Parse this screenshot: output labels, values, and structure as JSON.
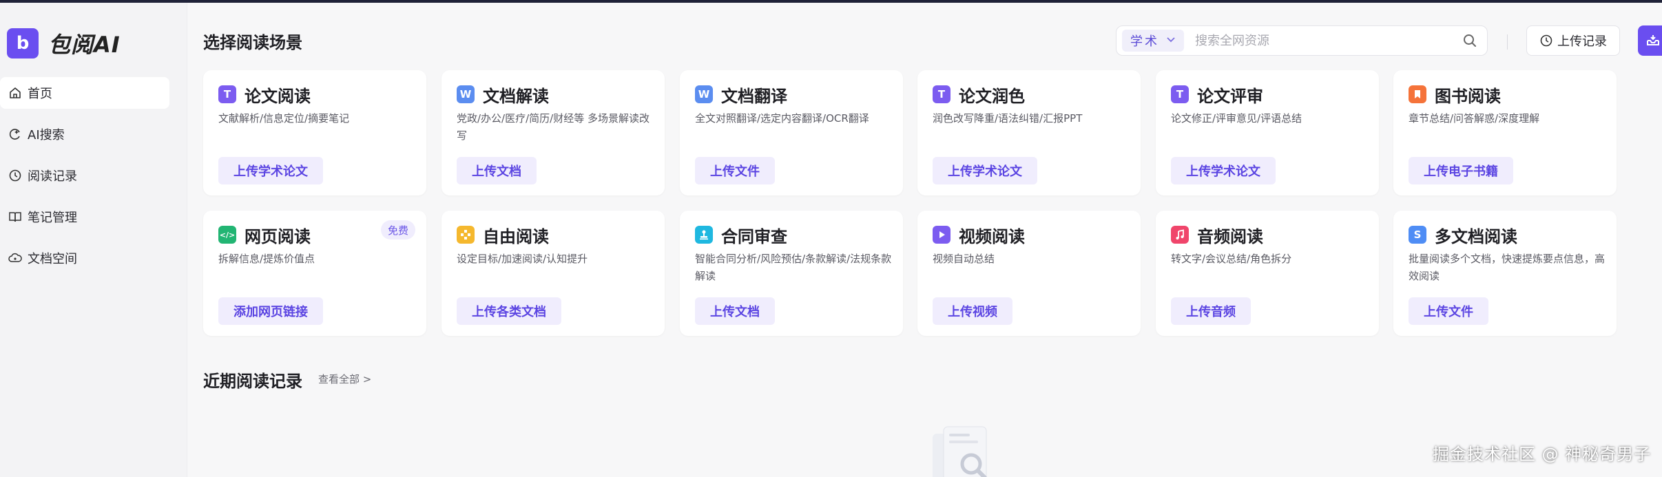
{
  "app": {
    "logo_letter": "b",
    "name": "包阅AI"
  },
  "sidebar": {
    "items": [
      {
        "label": "首页",
        "icon": "home-icon",
        "active": true
      },
      {
        "label": "AI搜索",
        "icon": "ai-search-icon"
      },
      {
        "label": "阅读记录",
        "icon": "clock-icon"
      },
      {
        "label": "笔记管理",
        "icon": "book-icon"
      },
      {
        "label": "文档空间",
        "icon": "cloud-folder-icon"
      }
    ]
  },
  "header": {
    "title": "选择阅读场景",
    "search": {
      "scope": "学术",
      "placeholder": "搜索全网资源"
    },
    "upload_record_label": "上传记录"
  },
  "cards": [
    {
      "title": "论文阅读",
      "icon": "T",
      "icon_color": "#7c5cf0",
      "desc": "文献解析/信息定位/摘要笔记",
      "button": "上传学术论文"
    },
    {
      "title": "文档解读",
      "icon": "W",
      "icon_color": "#5b8df0",
      "desc": "党政/办公/医疗/简历/财经等 多场景解读改写",
      "button": "上传文档"
    },
    {
      "title": "文档翻译",
      "icon": "W",
      "icon_color": "#5b8df0",
      "desc": "全文对照翻译/选定内容翻译/OCR翻译",
      "button": "上传文件"
    },
    {
      "title": "论文润色",
      "icon": "T",
      "icon_color": "#7c5cf0",
      "desc": "润色改写降重/语法纠错/汇报PPT",
      "button": "上传学术论文"
    },
    {
      "title": "论文评审",
      "icon": "T",
      "icon_color": "#7c5cf0",
      "desc": "论文修正/评审意见/评语总结",
      "button": "上传学术论文"
    },
    {
      "title": "图书阅读",
      "icon": "bookmark",
      "icon_color": "#f5733a",
      "desc": "章节总结/问答解惑/深度理解",
      "button": "上传电子书籍"
    },
    {
      "title": "网页阅读",
      "icon": "</>",
      "icon_color": "#22b573",
      "desc": "拆解信息/提炼价值点",
      "button": "添加网页链接",
      "badge": "免费"
    },
    {
      "title": "自由阅读",
      "icon": "grid",
      "icon_color": "#f5b82e",
      "desc": "设定目标/加速阅读/认知提升",
      "button": "上传各类文档"
    },
    {
      "title": "合同审查",
      "icon": "stamp",
      "icon_color": "#1fb8e0",
      "desc": "智能合同分析/风险预估/条款解读/法规条款解读",
      "button": "上传文档"
    },
    {
      "title": "视频阅读",
      "icon": "play",
      "icon_color": "#7c5cf0",
      "desc": "视频自动总结",
      "button": "上传视频"
    },
    {
      "title": "音频阅读",
      "icon": "music",
      "icon_color": "#f0456b",
      "desc": "转文字/会议总结/角色拆分",
      "button": "上传音频"
    },
    {
      "title": "多文档阅读",
      "icon": "S",
      "icon_color": "#4f8df5",
      "desc": "批量阅读多个文档，快速提炼要点信息，高效阅读",
      "button": "上传文件"
    }
  ],
  "recent": {
    "title": "近期阅读记录",
    "view_all": "查看全部  >"
  },
  "watermark": "掘金技术社区 @ 神秘奇男子"
}
